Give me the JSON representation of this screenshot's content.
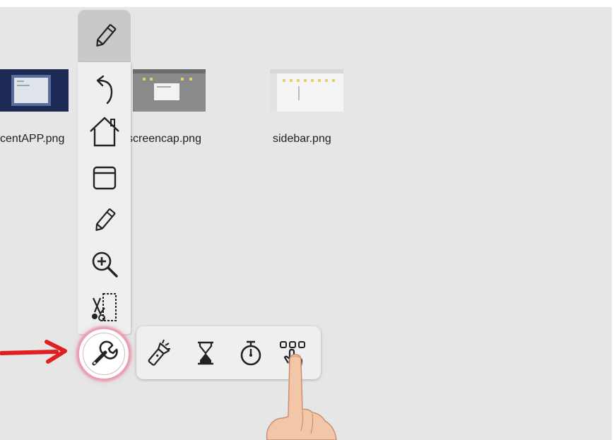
{
  "desktop": {
    "files": [
      {
        "name": "centAPP.png"
      },
      {
        "name": "screencap.png"
      },
      {
        "name": "sidebar.png"
      }
    ]
  },
  "toolbar": {
    "header_icon": "pencil-icon",
    "buttons": [
      {
        "icon": "undo-arrow-icon"
      },
      {
        "icon": "home-icon"
      },
      {
        "icon": "window-icon"
      },
      {
        "icon": "pencil-icon"
      },
      {
        "icon": "zoom-in-icon"
      },
      {
        "icon": "screenshot-crop-icon"
      },
      {
        "icon": "wrench-icon",
        "highlighted": true
      }
    ]
  },
  "tools_subbar": {
    "items": [
      {
        "icon": "spotlight-icon"
      },
      {
        "icon": "hourglass-icon"
      },
      {
        "icon": "stopwatch-icon"
      },
      {
        "icon": "multi-select-icon"
      }
    ]
  },
  "colors": {
    "desktop_bg": "#e6e6e6",
    "toolbar_bg": "#efefef",
    "toolbar_header": "#c9c9c9",
    "highlight_ring": "#e8a0b0",
    "arrow": "#e02020"
  }
}
